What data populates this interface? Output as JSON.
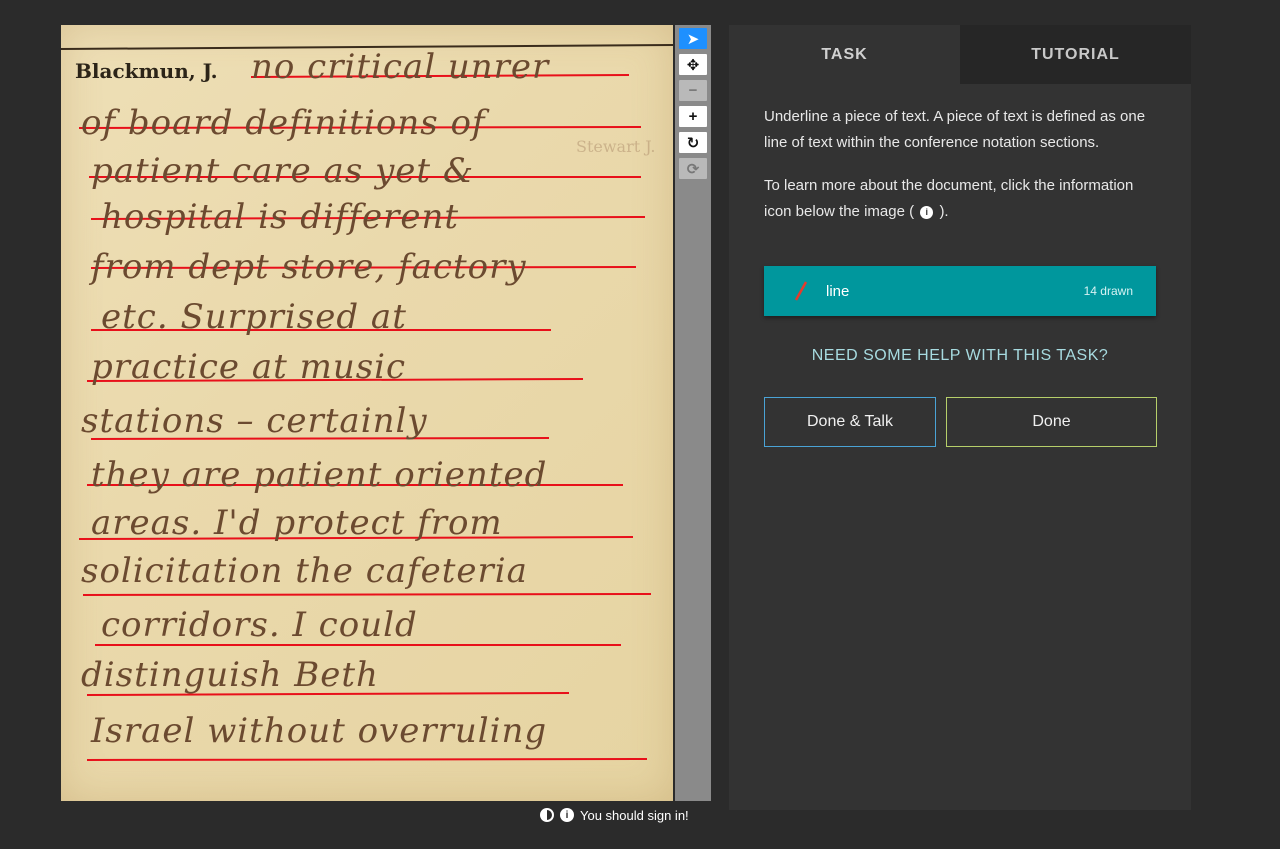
{
  "document": {
    "header": "Blackmun, J.",
    "handwritten_lines": [
      "no critical unrer",
      "of board definitions of",
      "patient care as yet &",
      "hospital is different",
      "from dept store, factory",
      "etc. Surprised at",
      "practice at music",
      "stations – certainly",
      "they are patient oriented",
      "areas. I'd protect from",
      "solicitation the cafeteria",
      "corridors. I could",
      "distinguish Beth",
      "Israel without overruling"
    ],
    "stamp_text": "Stewart J."
  },
  "toolbar": {
    "tools": [
      {
        "icon": "pointer-icon",
        "glyph": "➤"
      },
      {
        "icon": "move-icon",
        "glyph": "✥"
      },
      {
        "icon": "zoom-out-icon",
        "glyph": "−"
      },
      {
        "icon": "zoom-in-icon",
        "glyph": "+"
      },
      {
        "icon": "rotate-icon",
        "glyph": "↻"
      },
      {
        "icon": "reset-icon",
        "glyph": "⟳"
      }
    ]
  },
  "footer": {
    "sign_in_text": "You should sign in!",
    "contrast_icon": "contrast-icon",
    "info_icon": "info-icon"
  },
  "panel": {
    "tabs": [
      {
        "label": "TASK",
        "active": true
      },
      {
        "label": "TUTORIAL",
        "active": false
      }
    ],
    "instruction_1": "Underline a piece of text. A piece of text is defined as one line of text within the conference notation sections.",
    "instruction_2_a": "To learn more about the document, click the information icon below the image (",
    "instruction_2_b": ").",
    "tool_label": "line",
    "tool_count": "14 drawn",
    "tool_color": "#e53a2c",
    "help_link": "NEED SOME HELP WITH THIS TASK?",
    "done_talk": "Done & Talk",
    "done": "Done"
  },
  "colors": {
    "accent": "#00979d",
    "underline_red": "#e8101a",
    "active_tool": "#1e90ff"
  }
}
